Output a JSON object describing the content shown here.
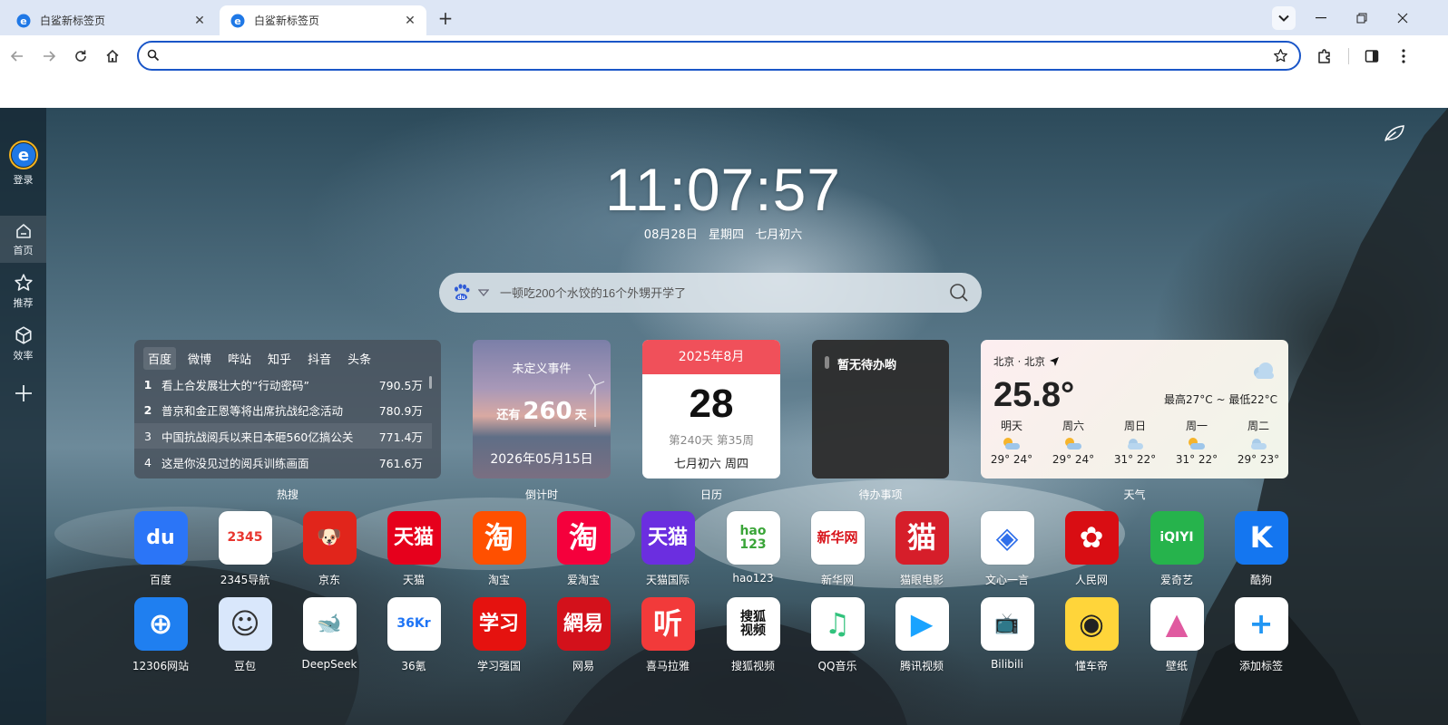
{
  "browser": {
    "tabs": [
      {
        "title": "白鲨新标签页",
        "active": false
      },
      {
        "title": "白鲨新标签页",
        "active": true
      }
    ],
    "address": {
      "value": "",
      "placeholder": ""
    }
  },
  "sidebar": {
    "login_label": "登录",
    "items": [
      {
        "label": "首页",
        "icon": "home-icon"
      },
      {
        "label": "推荐",
        "icon": "star-icon"
      },
      {
        "label": "效率",
        "icon": "cube-icon"
      }
    ]
  },
  "clock": {
    "time": "11:07:57",
    "date": "08月28日",
    "weekday": "星期四",
    "lunar": "七月初六"
  },
  "search": {
    "placeholder": "一顿吃200个水饺的16个外甥开学了",
    "engine_icon": "baidu-paw-icon"
  },
  "hot": {
    "tabs": [
      "百度",
      "微博",
      "哔站",
      "知乎",
      "抖音",
      "头条"
    ],
    "active_tab": "百度",
    "items": [
      {
        "rank": "1",
        "title": "看上合发展壮大的“行动密码”",
        "count": "790.5万"
      },
      {
        "rank": "2",
        "title": "普京和金正恩等将出席抗战纪念活动",
        "count": "780.9万"
      },
      {
        "rank": "3",
        "title": "中国抗战阅兵以来日本砸560亿搞公关",
        "count": "771.4万"
      },
      {
        "rank": "4",
        "title": "这是你没见过的阅兵训练画面",
        "count": "761.6万"
      }
    ],
    "caption": "热搜"
  },
  "countdown": {
    "event": "未定义事件",
    "prefix": "还有",
    "days": "260",
    "suffix": "天",
    "target": "2026年05月15日",
    "caption": "倒计时"
  },
  "calendar": {
    "month": "2025年8月",
    "day": "28",
    "week": "第240天 第35周",
    "lunar": "七月初六 周四",
    "caption": "日历"
  },
  "todo": {
    "empty": "暂无待办哟",
    "caption": "待办事项"
  },
  "weather": {
    "location": "北京 · 北京",
    "temp": "25.8°",
    "range": "最高27°C ~ 最低22°C",
    "forecast": [
      {
        "day": "明天",
        "range": "29° 24°"
      },
      {
        "day": "周六",
        "range": "29° 24°"
      },
      {
        "day": "周日",
        "range": "31° 22°"
      },
      {
        "day": "周一",
        "range": "31° 22°"
      },
      {
        "day": "周二",
        "range": "29° 23°"
      }
    ],
    "caption": "天气"
  },
  "apps": [
    {
      "label": "百度",
      "icon": "baidu-icon",
      "glyph": "du",
      "bg": "#2b75f7",
      "fg": "#ffffff"
    },
    {
      "label": "2345导航",
      "icon": "2345-icon",
      "glyph": "2345",
      "bg": "#ffffff",
      "fg": "#e8352e"
    },
    {
      "label": "京东",
      "icon": "jd-icon",
      "glyph": "🐶",
      "bg": "#e1251b",
      "fg": "#ffffff"
    },
    {
      "label": "天猫",
      "icon": "tmall-icon",
      "glyph": "天猫",
      "bg": "#e6001c",
      "fg": "#ffffff"
    },
    {
      "label": "淘宝",
      "icon": "taobao-icon",
      "glyph": "淘",
      "bg": "#ff5000",
      "fg": "#ffffff"
    },
    {
      "label": "爱淘宝",
      "icon": "aitaobao-icon",
      "glyph": "淘",
      "bg": "#f5003c",
      "fg": "#ffffff"
    },
    {
      "label": "天猫国际",
      "icon": "tmall-global-icon",
      "glyph": "天猫",
      "bg": "#6b2ee0",
      "fg": "#ffffff"
    },
    {
      "label": "hao123",
      "icon": "hao123-icon",
      "glyph": "hao\n123",
      "bg": "#ffffff",
      "fg": "#3aa538"
    },
    {
      "label": "新华网",
      "icon": "xinhua-icon",
      "glyph": "新华网",
      "bg": "#ffffff",
      "fg": "#d8141b"
    },
    {
      "label": "猫眼电影",
      "icon": "maoyan-icon",
      "glyph": "猫",
      "bg": "#d61e2a",
      "fg": "#ffffff"
    },
    {
      "label": "文心一言",
      "icon": "wenxin-icon",
      "glyph": "◈",
      "bg": "#ffffff",
      "fg": "#2f6fea"
    },
    {
      "label": "人民网",
      "icon": "people-icon",
      "glyph": "✿",
      "bg": "#d90d13",
      "fg": "#ffffff"
    },
    {
      "label": "爱奇艺",
      "icon": "iqiyi-icon",
      "glyph": "iQIYI",
      "bg": "#26b34c",
      "fg": "#ffffff"
    },
    {
      "label": "酷狗",
      "icon": "kugou-icon",
      "glyph": "K",
      "bg": "#1476f0",
      "fg": "#ffffff"
    },
    {
      "label": "12306网站",
      "icon": "12306-icon",
      "glyph": "⊕",
      "bg": "#1f7ff0",
      "fg": "#ffffff"
    },
    {
      "label": "豆包",
      "icon": "doubao-icon",
      "glyph": "☺",
      "bg": "#d9e7fb",
      "fg": "#333333"
    },
    {
      "label": "DeepSeek",
      "icon": "deepseek-icon",
      "glyph": "🐋",
      "bg": "#ffffff",
      "fg": "#4d6bfe"
    },
    {
      "label": "36氪",
      "icon": "36kr-icon",
      "glyph": "36Kr",
      "bg": "#ffffff",
      "fg": "#1e74f5"
    },
    {
      "label": "学习强国",
      "icon": "xuexi-icon",
      "glyph": "学习",
      "bg": "#e5120f",
      "fg": "#ffffff"
    },
    {
      "label": "网易",
      "icon": "netease-icon",
      "glyph": "網易",
      "bg": "#d3111b",
      "fg": "#ffffff"
    },
    {
      "label": "喜马拉雅",
      "icon": "ximalaya-icon",
      "glyph": "听",
      "bg": "#f23a3a",
      "fg": "#ffffff"
    },
    {
      "label": "搜狐视频",
      "icon": "sohu-video-icon",
      "glyph": "搜狐\n视频",
      "bg": "#ffffff",
      "fg": "#111111"
    },
    {
      "label": "QQ音乐",
      "icon": "qqmusic-icon",
      "glyph": "♫",
      "bg": "#ffffff",
      "fg": "#31c27c"
    },
    {
      "label": "腾讯视频",
      "icon": "tencent-video-icon",
      "glyph": "▶",
      "bg": "#ffffff",
      "fg": "#1aa3ff"
    },
    {
      "label": "Bilibili",
      "icon": "bilibili-icon",
      "glyph": "📺",
      "bg": "#ffffff",
      "fg": "#1fa6dd"
    },
    {
      "label": "懂车帝",
      "icon": "dongchedi-icon",
      "glyph": "◉",
      "bg": "#ffd53a",
      "fg": "#222222"
    },
    {
      "label": "壁纸",
      "icon": "wallpaper-icon",
      "glyph": "▲",
      "bg": "#ffffff",
      "fg": "#e05aa0"
    },
    {
      "label": "添加标签",
      "icon": "add-tile-icon",
      "glyph": "+",
      "bg": "#ffffff",
      "fg": "#2196f3"
    }
  ]
}
